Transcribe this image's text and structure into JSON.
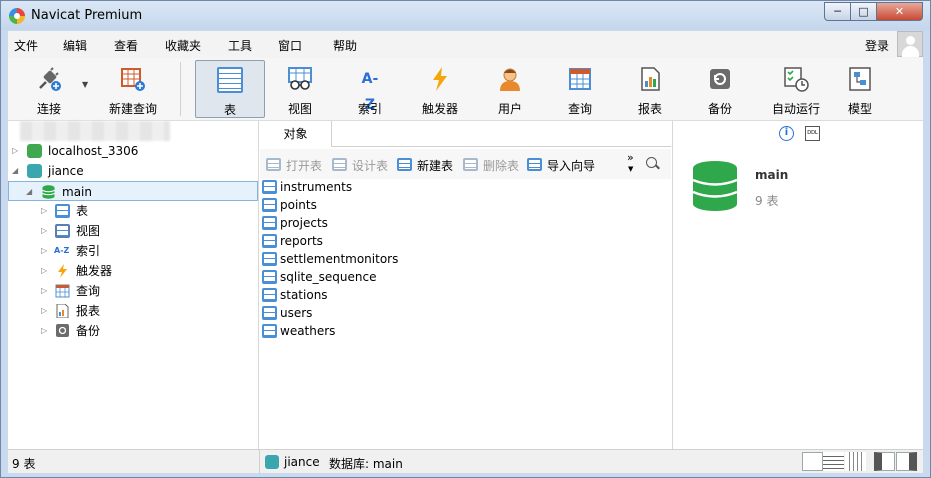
{
  "window": {
    "title": "Navicat Premium",
    "min": "─",
    "max": "□",
    "close": "✕"
  },
  "menu": [
    "文件",
    "编辑",
    "查看",
    "收藏夹",
    "工具",
    "窗口",
    "帮助"
  ],
  "login": "登录",
  "toolbar": {
    "connect": "连接",
    "new_query": "新建查询",
    "table": "表",
    "view": "视图",
    "index": "索引",
    "trigger": "触发器",
    "user": "用户",
    "query": "查询",
    "report": "报表",
    "backup": "备份",
    "automation": "自动运行",
    "model": "模型",
    "index_glyph": "A-Z"
  },
  "tree": {
    "conn1": "localhost_3306",
    "conn2": "jiance",
    "db": "main",
    "items": [
      "表",
      "视图",
      "索引",
      "触发器",
      "查询",
      "报表",
      "备份"
    ]
  },
  "tabs": {
    "objects": "对象"
  },
  "obj_toolbar": {
    "open": "打开表",
    "design": "设计表",
    "new": "新建表",
    "delete": "删除表",
    "import": "导入向导",
    "more": "»"
  },
  "tables": [
    "instruments",
    "points",
    "projects",
    "reports",
    "settlementmonitors",
    "sqlite_sequence",
    "stations",
    "users",
    "weathers"
  ],
  "info": {
    "name": "main",
    "count": "9 表",
    "info_glyph": "i",
    "ddl": "DDL"
  },
  "status": {
    "left": "9 表",
    "conn": "jiance",
    "db": "数据库: main"
  },
  "colors": {
    "accent": "#4a8fd6",
    "db_green": "#2ea84a",
    "selection": "#e5f1fb"
  }
}
